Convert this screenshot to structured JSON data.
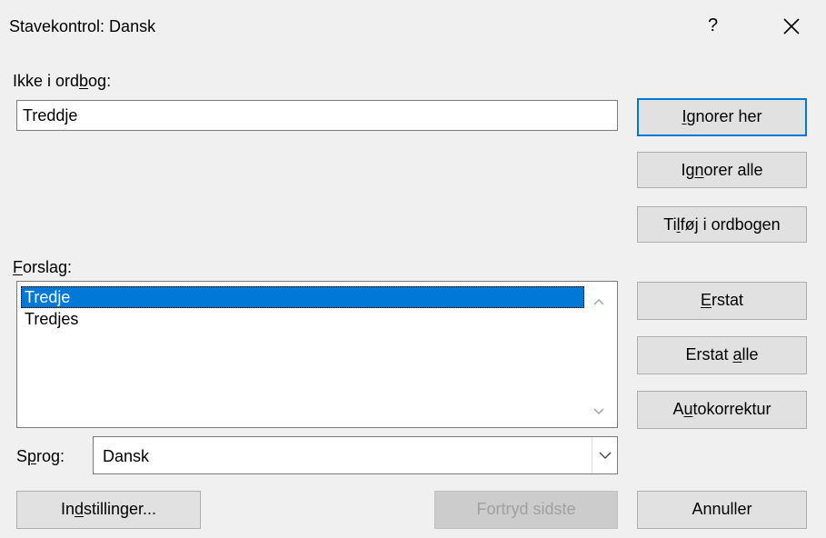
{
  "window": {
    "title": "Stavekontrol: Dansk",
    "help": "?"
  },
  "not_in_dictionary": {
    "label": "Ikke i ordbog:",
    "value": "Treddje"
  },
  "suggestions": {
    "label": "Forslag:",
    "items": [
      "Tredje",
      "Tredjes"
    ],
    "selected_index": 0
  },
  "language": {
    "label": "Sprog:",
    "value": "Dansk"
  },
  "buttons": {
    "ignore_once": "Ignorer her",
    "ignore_all": "Ignorer alle",
    "add_to_dictionary": "Tilføj i ordbogen",
    "change": "Erstat",
    "change_all": "Erstat alle",
    "autocorrect": "Autokorrektur",
    "options": "Indstillinger...",
    "undo_last": "Fortryd sidste",
    "cancel": "Annuller"
  },
  "colors": {
    "background": "#f0f0f0",
    "selection": "#0078d7",
    "default_button_border": "#0078d7"
  }
}
